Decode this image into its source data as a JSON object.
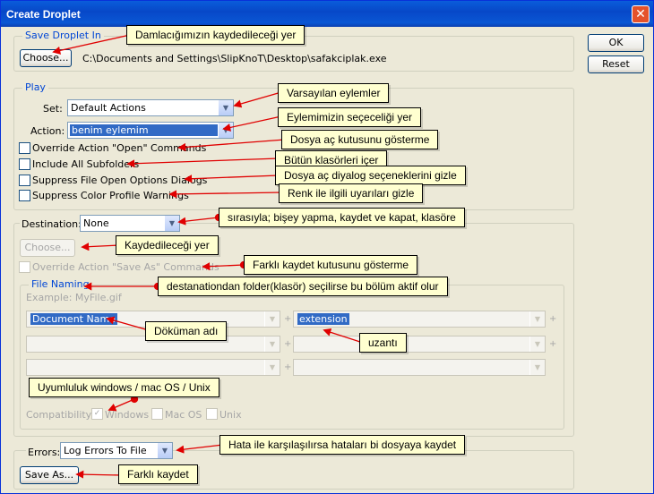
{
  "window": {
    "title": "Create Droplet",
    "close_glyph": "✕"
  },
  "buttons": {
    "ok": "OK",
    "reset": "Reset"
  },
  "save_in": {
    "legend": "Save Droplet In",
    "choose_label": "Choose...",
    "path": "C:\\Documents and Settings\\SlipKnoT\\Desktop\\safakciplak.exe"
  },
  "play": {
    "legend": "Play",
    "set_label": "Set:",
    "set_value": "Default Actions",
    "action_label": "Action:",
    "action_value": "benim eylemim",
    "options": [
      "Override Action \"Open\" Commands",
      "Include All Subfolders",
      "Suppress File Open Options Dialogs",
      "Suppress Color Profile Warnings"
    ]
  },
  "destination": {
    "label": "Destination:",
    "value": "None",
    "choose_label": "Choose...",
    "override_label": "Override Action \"Save As\" Commands",
    "file_naming": {
      "legend": "File Naming",
      "example": "Example: MyFile.gif",
      "fields": [
        "Document Name",
        "extension",
        "",
        "",
        "",
        ""
      ],
      "plus": "+",
      "compat_label": "Compatibility:",
      "compat_options": [
        "Windows",
        "Mac OS",
        "Unix"
      ]
    }
  },
  "errors": {
    "label": "Errors:",
    "value": "Log Errors To File",
    "save_as_label": "Save As..."
  },
  "annotations": [
    "Damlacığımızın kaydedileceği yer",
    "Varsayılan eylemler",
    "Eylemimizin seçeceliği yer",
    "Dosya aç kutusunu gösterme",
    "Bütün klasörleri içer",
    "Dosya aç diyalog seçeneklerini gizle",
    "Renk ile ilgili uyarıları gizle",
    "sırasıyla; bişey yapma, kaydet ve kapat, klasöre",
    "Kaydedileceği yer",
    "Farklı kaydet kutusunu gösterme",
    "destanationdan folder(klasör) seçilirse bu bölüm aktif olur",
    "Döküman adı",
    "uzantı",
    "Uyumluluk windows / mac OS / Unix",
    "Hata ile karşılaşılırsa hataları bi dosyaya kaydet",
    "Farklı kaydet"
  ],
  "colors": {
    "annotation_arrow": "#e00000",
    "tooltip_bg": "#ffffd0",
    "title_bar": "#0a5ddb"
  }
}
